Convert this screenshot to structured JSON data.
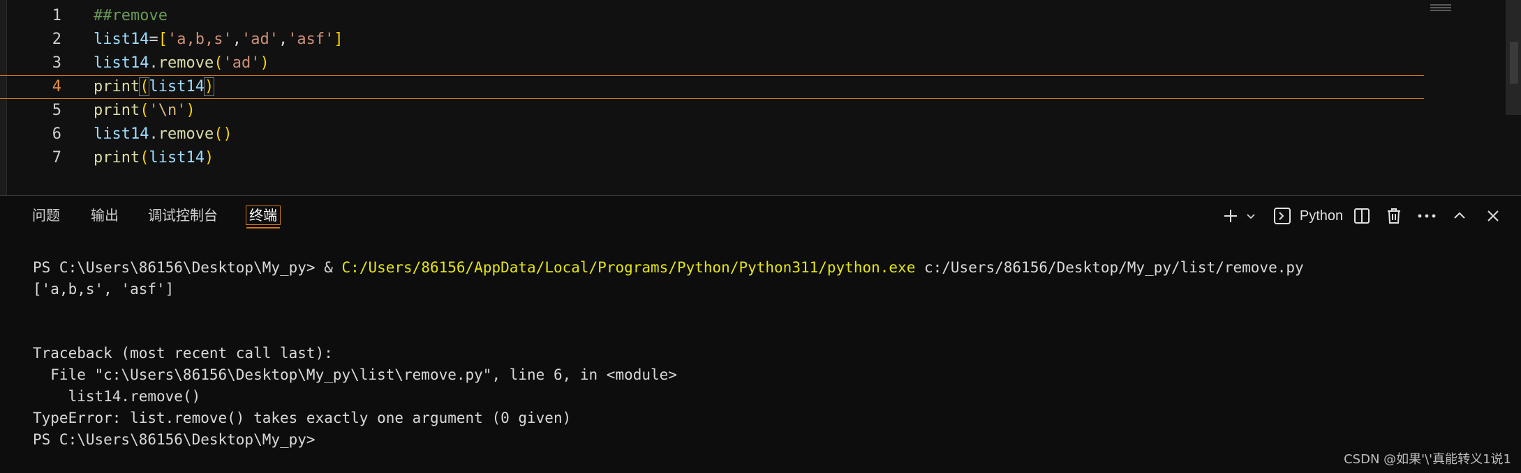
{
  "editor": {
    "lines": [
      {
        "num": "1",
        "tokens": [
          {
            "t": "##remove",
            "c": "comment"
          }
        ]
      },
      {
        "num": "2",
        "tokens": [
          {
            "t": "list14",
            "c": "ident"
          },
          {
            "t": "=",
            "c": "op"
          },
          {
            "t": "[",
            "c": "paren"
          },
          {
            "t": "'a,b,s'",
            "c": "str"
          },
          {
            "t": ",",
            "c": "op"
          },
          {
            "t": "'ad'",
            "c": "str"
          },
          {
            "t": ",",
            "c": "op"
          },
          {
            "t": "'asf'",
            "c": "str"
          },
          {
            "t": "]",
            "c": "paren"
          }
        ]
      },
      {
        "num": "3",
        "tokens": [
          {
            "t": "list14",
            "c": "ident"
          },
          {
            "t": ".",
            "c": "op"
          },
          {
            "t": "remove",
            "c": "func"
          },
          {
            "t": "(",
            "c": "paren"
          },
          {
            "t": "'ad'",
            "c": "str"
          },
          {
            "t": ")",
            "c": "paren"
          }
        ]
      },
      {
        "num": "4",
        "tokens": [
          {
            "t": "print",
            "c": "func"
          },
          {
            "t": "(",
            "c": "paren box"
          },
          {
            "t": "list14",
            "c": "ident"
          },
          {
            "t": ")",
            "c": "paren box"
          }
        ]
      },
      {
        "num": "5",
        "tokens": [
          {
            "t": "print",
            "c": "func"
          },
          {
            "t": "(",
            "c": "paren"
          },
          {
            "t": "'",
            "c": "str"
          },
          {
            "t": "\\n",
            "c": "esc"
          },
          {
            "t": "'",
            "c": "str"
          },
          {
            "t": ")",
            "c": "paren"
          }
        ]
      },
      {
        "num": "6",
        "tokens": [
          {
            "t": "list14",
            "c": "ident"
          },
          {
            "t": ".",
            "c": "op"
          },
          {
            "t": "remove",
            "c": "func"
          },
          {
            "t": "()",
            "c": "paren"
          }
        ]
      },
      {
        "num": "7",
        "tokens": [
          {
            "t": "print",
            "c": "func"
          },
          {
            "t": "(",
            "c": "paren"
          },
          {
            "t": "list14",
            "c": "ident"
          },
          {
            "t": ")",
            "c": "paren"
          }
        ]
      }
    ],
    "current_line": "4"
  },
  "panel": {
    "tabs": [
      "问题",
      "输出",
      "调试控制台",
      "终端"
    ],
    "active_tab": "终端",
    "toolbar": {
      "add_icon": "plus-icon",
      "dropdown_icon": "chevron-down-icon",
      "terminal_icon": "terminal-icon",
      "shell_label": "Python",
      "split_icon": "split-icon",
      "trash_icon": "trash-icon",
      "more_icon": "ellipsis-icon",
      "maximize_icon": "chevron-up-icon",
      "close_icon": "close-icon"
    }
  },
  "terminal": {
    "prompt1": "PS C:\\Users\\86156\\Desktop\\My_py> ",
    "amp": "& ",
    "exe_path": "C:/Users/86156/AppData/Local/Programs/Python/Python311/python.exe",
    "script_arg": " c:/Users/86156/Desktop/My_py/list/remove.py",
    "output1": "['a,b,s', 'asf']",
    "traceback_header": "Traceback (most recent call last):",
    "traceback_file": "  File \"c:\\Users\\86156\\Desktop\\My_py\\list\\remove.py\", line 6, in <module>",
    "traceback_code": "    list14.remove()",
    "error": "TypeError: list.remove() takes exactly one argument (0 given)",
    "prompt2": "PS C:\\Users\\86156\\Desktop\\My_py>"
  },
  "watermark": "CSDN @如果'\\'真能转义1说1",
  "colors": {
    "accent_orange": "#d07a1a",
    "terminal_yellow": "#e5e510",
    "background": "#0d0d0d"
  }
}
